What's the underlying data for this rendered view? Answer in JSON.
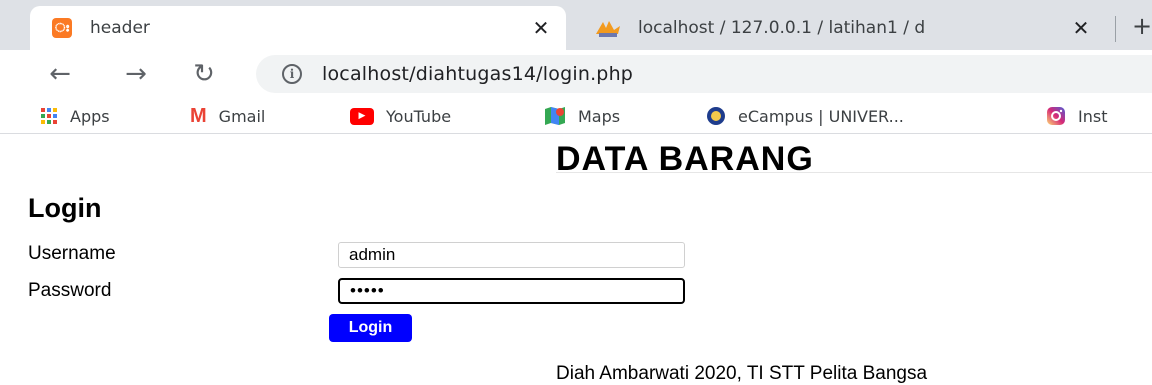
{
  "browser": {
    "tabs": [
      {
        "title": "header",
        "favicon": "xampp-icon",
        "favicon_text": "ഃ",
        "active": true
      },
      {
        "title": "localhost / 127.0.0.1 / latihan1 / d",
        "favicon": "phpmyadmin-icon",
        "active": false
      }
    ],
    "close_glyph": "✕",
    "new_tab_glyph": "+",
    "nav": {
      "back": "←",
      "forward": "→",
      "reload": "↻"
    },
    "info_glyph": "i",
    "url": "localhost/diahtugas14/login.php",
    "bookmarks": [
      {
        "label": "Apps",
        "icon": "apps-grid-icon"
      },
      {
        "label": "Gmail",
        "icon": "gmail-icon",
        "glyph": "M"
      },
      {
        "label": "YouTube",
        "icon": "youtube-icon",
        "glyph": "▶"
      },
      {
        "label": "Maps",
        "icon": "maps-icon"
      },
      {
        "label": "eCampus | UNIVER...",
        "icon": "ecampus-icon"
      },
      {
        "label": "Inst",
        "icon": "instagram-icon"
      }
    ]
  },
  "page": {
    "title": "DATA BARANG",
    "login_heading": "Login",
    "username_label": "Username",
    "username_value": "admin",
    "password_label": "Password",
    "password_value": "admin",
    "login_button": "Login",
    "footer": "Diah Ambarwati 2020, TI STT Pelita Bangsa"
  },
  "colors": {
    "tabstrip": "#dee1e6",
    "login_button": "#0000ff",
    "xampp": "#fb7a24",
    "gmail": "#ea4335",
    "youtube": "#ff0000"
  }
}
